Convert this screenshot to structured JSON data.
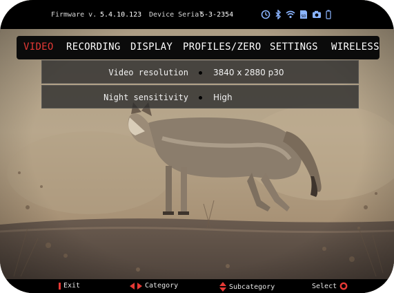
{
  "status": {
    "firmware_label": "Firmware v.",
    "firmware_value": "5.4.10.123",
    "serial_label": "Device Serial",
    "serial_value": "5-3-2354",
    "icons": [
      "timer-icon",
      "bluetooth-icon",
      "wifi-icon",
      "sd-card-icon",
      "camera-icon",
      "battery-icon"
    ],
    "sd_label": "SD"
  },
  "menu": {
    "tabs": [
      {
        "label": "VIDEO",
        "active": true
      },
      {
        "label": "RECORDING",
        "active": false
      },
      {
        "label": "DISPLAY",
        "active": false
      },
      {
        "label": "PROFILES/ZERO",
        "active": false
      },
      {
        "label": "SETTINGS",
        "active": false
      },
      {
        "label": "WIRELESS",
        "active": false
      }
    ]
  },
  "settings": [
    {
      "label": "Video resolution",
      "value": "3840 x 2880 p30"
    },
    {
      "label": "Night sensitivity",
      "value": "High"
    }
  ],
  "footer": {
    "exit": "Exit",
    "category": "Category",
    "subcategory": "Subcategory",
    "select": "Select"
  },
  "colors": {
    "accent": "#e53935",
    "menu_bg": "#0b0b0b",
    "row_bg": "#2d2d2d"
  }
}
